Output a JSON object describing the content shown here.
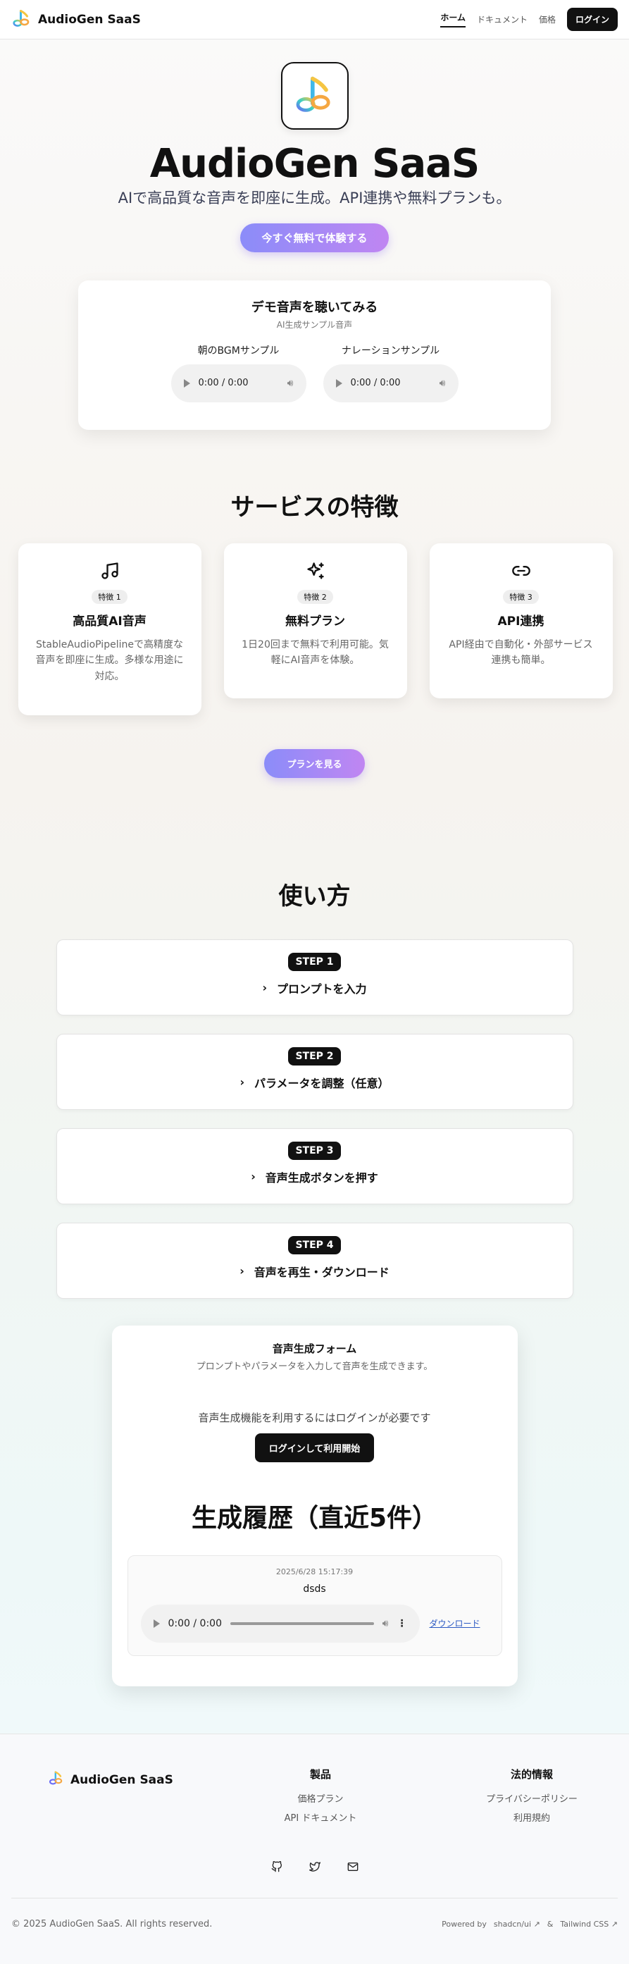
{
  "header": {
    "brand": "AudioGen SaaS",
    "nav": [
      "ホーム",
      "ドキュメント",
      "価格"
    ],
    "login": "ログイン"
  },
  "hero": {
    "title": "AudioGen SaaS",
    "subtitle": "AIで高品質な音声を即座に生成。API連携や無料プランも。",
    "cta": "今すぐ無料で体験する"
  },
  "demo": {
    "title": "デモ音声を聴いてみる",
    "subtitle": "AI生成サンプル音声",
    "samples": [
      {
        "label": "朝のBGMサンプル",
        "time": "0:00 / 0:00"
      },
      {
        "label": "ナレーションサンプル",
        "time": "0:00 / 0:00"
      }
    ]
  },
  "features": {
    "title": "サービスの特徴",
    "items": [
      {
        "icon": "music-note-icon",
        "badge": "特徴 1",
        "title": "高品質AI音声",
        "desc": "StableAudioPipelineで高精度な音声を即座に生成。多様な用途に対応。"
      },
      {
        "icon": "sparkles-icon",
        "badge": "特徴 2",
        "title": "無料プラン",
        "desc": "1日20回まで無料で利用可能。気軽にAI音声を体験。"
      },
      {
        "icon": "link-icon",
        "badge": "特徴 3",
        "title": "API連携",
        "desc": "API経由で自動化・外部サービス連携も簡単。"
      }
    ],
    "plan_button": "プランを見る"
  },
  "howto": {
    "title": "使い方",
    "steps": [
      {
        "badge": "STEP 1",
        "label": "プロンプトを入力"
      },
      {
        "badge": "STEP 2",
        "label": "パラメータを調整（任意）"
      },
      {
        "badge": "STEP 3",
        "label": "音声生成ボタンを押す"
      },
      {
        "badge": "STEP 4",
        "label": "音声を再生・ダウンロード"
      }
    ]
  },
  "form": {
    "title": "音声生成フォーム",
    "subtitle": "プロンプトやパラメータを入力して音声を生成できます。",
    "notice": "音声生成機能を利用するにはログインが必要です",
    "login_button": "ログインして利用開始",
    "history_title": "生成履歴（直近5件）",
    "history": [
      {
        "time": "2025/6/28 15:17:39",
        "name": "dsds",
        "player_time": "0:00 / 0:00",
        "download": "ダウンロード"
      }
    ]
  },
  "footer": {
    "brand": "AudioGen SaaS",
    "product_title": "製品",
    "product_links": [
      "価格プラン",
      "API ドキュメント"
    ],
    "legal_title": "法的情報",
    "legal_links": [
      "プライバシーポリシー",
      "利用規約"
    ],
    "copyright": "© 2025 AudioGen SaaS. All rights reserved.",
    "powered_by": "Powered by",
    "shadcn": "shadcn/ui",
    "amp": "&",
    "tailwind": "Tailwind CSS"
  },
  "colors": {
    "accent_gradient_start": "#8b8cf9",
    "accent_gradient_end": "#c086f2",
    "primary": "#111111"
  }
}
